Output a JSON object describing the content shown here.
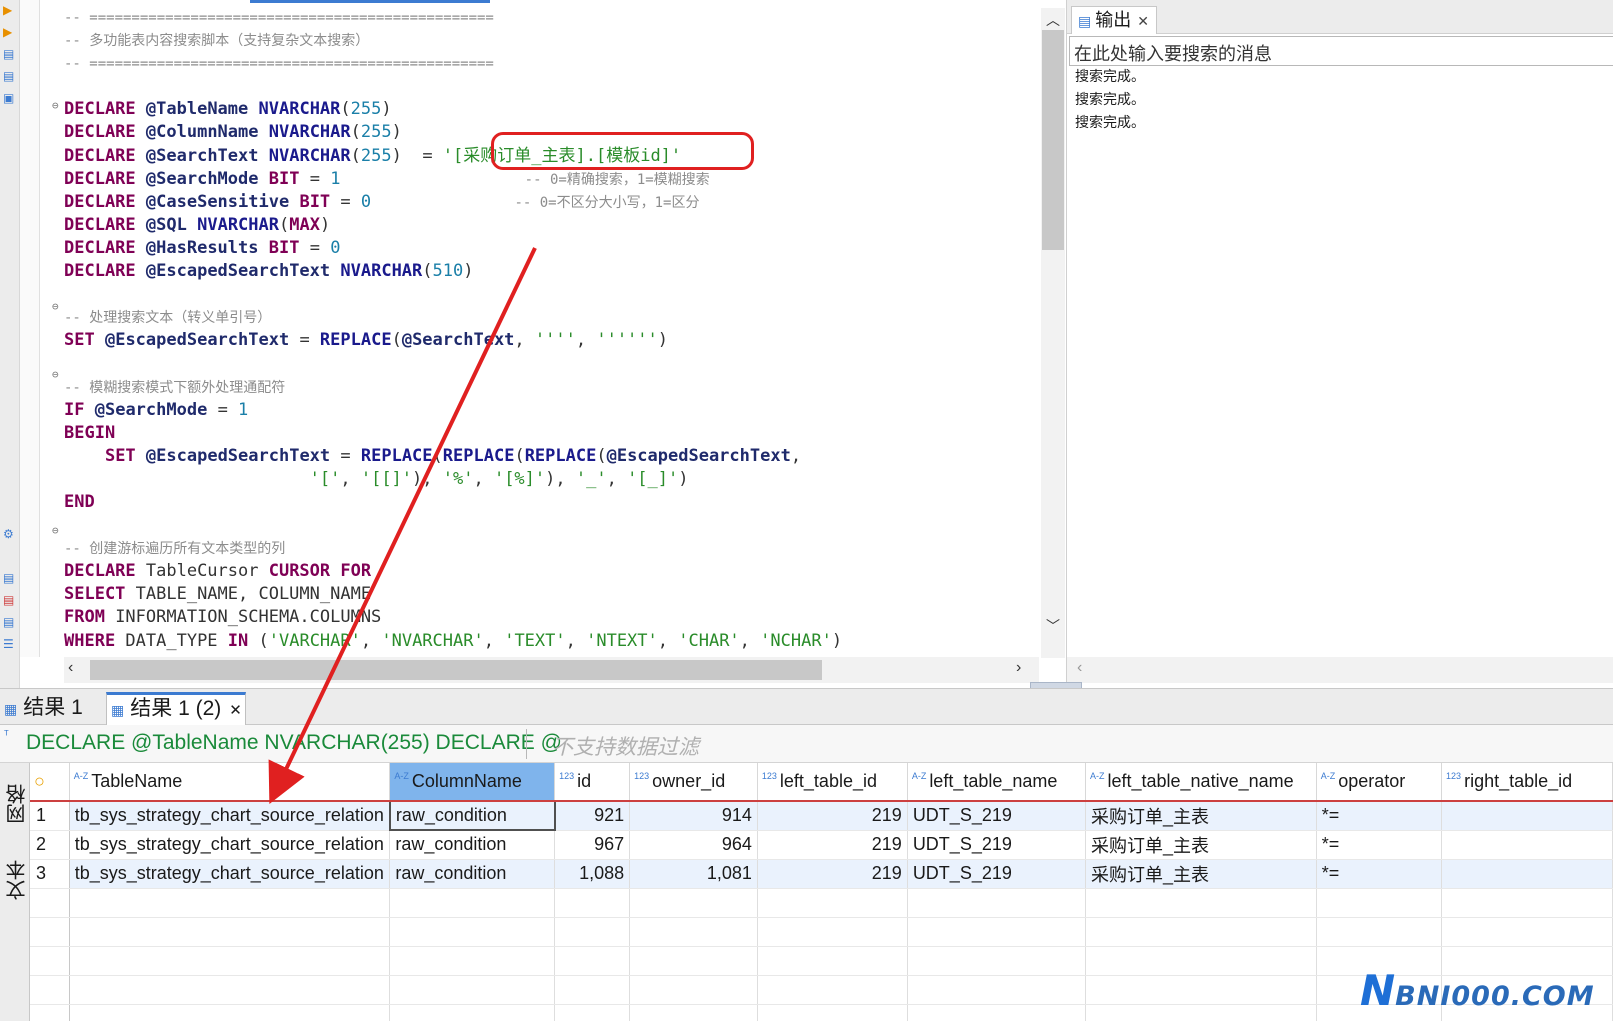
{
  "editor": {
    "lines": [
      [
        [
          "cmt",
          "-- ================================================"
        ]
      ],
      [
        [
          "cmt",
          "-- 多功能表内容搜索脚本（支持复杂文本搜索）"
        ]
      ],
      [
        [
          "cmt",
          "-- ================================================"
        ]
      ],
      [
        [
          "plain",
          ""
        ]
      ],
      [
        [
          "kw",
          "DECLARE"
        ],
        [
          "plain",
          " "
        ],
        [
          "var",
          "@TableName"
        ],
        [
          "plain",
          " "
        ],
        [
          "fn",
          "NVARCHAR"
        ],
        [
          "plain",
          "("
        ],
        [
          "num",
          "255"
        ],
        [
          "plain",
          ")"
        ]
      ],
      [
        [
          "kw",
          "DECLARE"
        ],
        [
          "plain",
          " "
        ],
        [
          "var",
          "@ColumnName"
        ],
        [
          "plain",
          " "
        ],
        [
          "fn",
          "NVARCHAR"
        ],
        [
          "plain",
          "("
        ],
        [
          "num",
          "255"
        ],
        [
          "plain",
          ")"
        ]
      ],
      [
        [
          "kw",
          "DECLARE"
        ],
        [
          "plain",
          " "
        ],
        [
          "var",
          "@SearchText"
        ],
        [
          "plain",
          " "
        ],
        [
          "fn",
          "NVARCHAR"
        ],
        [
          "plain",
          "("
        ],
        [
          "num",
          "255"
        ],
        [
          "plain",
          ")  = "
        ],
        [
          "str",
          "'[采购订单_主表].[模板id]'"
        ]
      ],
      [
        [
          "kw",
          "DECLARE"
        ],
        [
          "plain",
          " "
        ],
        [
          "var",
          "@SearchMode"
        ],
        [
          "plain",
          " "
        ],
        [
          "kw",
          "BIT"
        ],
        [
          "plain",
          " = "
        ],
        [
          "num",
          "1"
        ],
        [
          "plain",
          "                  "
        ],
        [
          "cmt",
          "-- 0=精确搜索，1=模糊搜索"
        ]
      ],
      [
        [
          "kw",
          "DECLARE"
        ],
        [
          "plain",
          " "
        ],
        [
          "var",
          "@CaseSensitive"
        ],
        [
          "plain",
          " "
        ],
        [
          "kw",
          "BIT"
        ],
        [
          "plain",
          " = "
        ],
        [
          "num",
          "0"
        ],
        [
          "plain",
          "              "
        ],
        [
          "cmt",
          "-- 0=不区分大小写，1=区分"
        ]
      ],
      [
        [
          "kw",
          "DECLARE"
        ],
        [
          "plain",
          " "
        ],
        [
          "var",
          "@SQL"
        ],
        [
          "plain",
          " "
        ],
        [
          "fn",
          "NVARCHAR"
        ],
        [
          "plain",
          "("
        ],
        [
          "kw",
          "MAX"
        ],
        [
          "plain",
          ")"
        ]
      ],
      [
        [
          "kw",
          "DECLARE"
        ],
        [
          "plain",
          " "
        ],
        [
          "var",
          "@HasResults"
        ],
        [
          "plain",
          " "
        ],
        [
          "kw",
          "BIT"
        ],
        [
          "plain",
          " = "
        ],
        [
          "num",
          "0"
        ]
      ],
      [
        [
          "kw",
          "DECLARE"
        ],
        [
          "plain",
          " "
        ],
        [
          "var",
          "@EscapedSearchText"
        ],
        [
          "plain",
          " "
        ],
        [
          "fn",
          "NVARCHAR"
        ],
        [
          "plain",
          "("
        ],
        [
          "num",
          "510"
        ],
        [
          "plain",
          ")"
        ]
      ],
      [
        [
          "plain",
          ""
        ]
      ],
      [
        [
          "cmt",
          "-- 处理搜索文本（转义单引号）"
        ]
      ],
      [
        [
          "kw",
          "SET"
        ],
        [
          "plain",
          " "
        ],
        [
          "var",
          "@EscapedSearchText"
        ],
        [
          "plain",
          " = "
        ],
        [
          "fn",
          "REPLACE"
        ],
        [
          "plain",
          "("
        ],
        [
          "var",
          "@SearchText"
        ],
        [
          "plain",
          ", "
        ],
        [
          "str",
          "''''"
        ],
        [
          "plain",
          ", "
        ],
        [
          "str",
          "''''''"
        ],
        [
          "plain",
          ")"
        ]
      ],
      [
        [
          "plain",
          ""
        ]
      ],
      [
        [
          "cmt",
          "-- 模糊搜索模式下额外处理通配符"
        ]
      ],
      [
        [
          "kw",
          "IF"
        ],
        [
          "plain",
          " "
        ],
        [
          "var",
          "@SearchMode"
        ],
        [
          "plain",
          " = "
        ],
        [
          "num",
          "1"
        ]
      ],
      [
        [
          "kw",
          "BEGIN"
        ]
      ],
      [
        [
          "plain",
          "    "
        ],
        [
          "kw",
          "SET"
        ],
        [
          "plain",
          " "
        ],
        [
          "var",
          "@EscapedSearchText"
        ],
        [
          "plain",
          " = "
        ],
        [
          "fn",
          "REPLACE"
        ],
        [
          "plain",
          "("
        ],
        [
          "fn",
          "REPLACE"
        ],
        [
          "plain",
          "("
        ],
        [
          "fn",
          "REPLACE"
        ],
        [
          "plain",
          "("
        ],
        [
          "var",
          "@EscapedSearchText"
        ],
        [
          "plain",
          ","
        ]
      ],
      [
        [
          "plain",
          "                        "
        ],
        [
          "str",
          "'['"
        ],
        [
          "plain",
          ", "
        ],
        [
          "str",
          "'[[]'"
        ],
        [
          "plain",
          "), "
        ],
        [
          "str",
          "'%'"
        ],
        [
          "plain",
          ", "
        ],
        [
          "str",
          "'[%]'"
        ],
        [
          "plain",
          "), "
        ],
        [
          "str",
          "'_'"
        ],
        [
          "plain",
          ", "
        ],
        [
          "str",
          "'[_]'"
        ],
        [
          "plain",
          ")"
        ]
      ],
      [
        [
          "kw",
          "END"
        ]
      ],
      [
        [
          "plain",
          ""
        ]
      ],
      [
        [
          "cmt",
          "-- 创建游标遍历所有文本类型的列"
        ]
      ],
      [
        [
          "kw",
          "DECLARE"
        ],
        [
          "plain",
          " TableCursor "
        ],
        [
          "kw",
          "CURSOR FOR"
        ]
      ],
      [
        [
          "kw",
          "SELECT"
        ],
        [
          "plain",
          " TABLE_NAME, COLUMN_NAME"
        ]
      ],
      [
        [
          "kw",
          "FROM"
        ],
        [
          "plain",
          " INFORMATION_SCHEMA.COLUMNS"
        ]
      ],
      [
        [
          "kw",
          "WHERE"
        ],
        [
          "plain",
          " DATA_TYPE "
        ],
        [
          "kw",
          "IN"
        ],
        [
          "plain",
          " ("
        ],
        [
          "str",
          "'VARCHAR'"
        ],
        [
          "plain",
          ", "
        ],
        [
          "str",
          "'NVARCHAR'"
        ],
        [
          "plain",
          ", "
        ],
        [
          "str",
          "'TEXT'"
        ],
        [
          "plain",
          ", "
        ],
        [
          "str",
          "'NTEXT'"
        ],
        [
          "plain",
          ", "
        ],
        [
          "str",
          "'CHAR'"
        ],
        [
          "plain",
          ", "
        ],
        [
          "str",
          "'NCHAR'"
        ],
        [
          "plain",
          ")"
        ]
      ]
    ]
  },
  "output": {
    "tab_label": "输出",
    "search_placeholder": "在此处输入要搜索的消息",
    "lines": [
      "搜索完成。",
      "搜索完成。",
      "搜索完成。"
    ]
  },
  "results": {
    "tabs": [
      "结果 1",
      "结果 1 (2)"
    ],
    "query_text": "DECLARE @TableName NVARCHAR(255) DECLARE @",
    "filter_placeholder": "不支持数据过滤",
    "side_tabs": [
      "网格",
      "文本"
    ],
    "columns": [
      {
        "label": "TableName",
        "type": "A-Z"
      },
      {
        "label": "ColumnName",
        "type": "A-Z"
      },
      {
        "label": "id",
        "type": "123"
      },
      {
        "label": "owner_id",
        "type": "123"
      },
      {
        "label": "left_table_id",
        "type": "123"
      },
      {
        "label": "left_table_name",
        "type": "A-Z"
      },
      {
        "label": "left_table_native_name",
        "type": "A-Z"
      },
      {
        "label": "operator",
        "type": "A-Z"
      },
      {
        "label": "right_table_id",
        "type": "123"
      }
    ],
    "rows": [
      [
        "1",
        "tb_sys_strategy_chart_source_relation",
        "raw_condition",
        "921",
        "914",
        "219",
        "UDT_S_219",
        "采购订单_主表",
        "*=",
        ""
      ],
      [
        "2",
        "tb_sys_strategy_chart_source_relation",
        "raw_condition",
        "967",
        "964",
        "219",
        "UDT_S_219",
        "采购订单_主表",
        "*=",
        ""
      ],
      [
        "3",
        "tb_sys_strategy_chart_source_relation",
        "raw_condition",
        "1,088",
        "1,081",
        "219",
        "UDT_S_219",
        "采购订单_主表",
        "*=",
        ""
      ]
    ]
  },
  "watermark": {
    "n": "N",
    "rest": "BNI000.COM"
  },
  "colors": {
    "accent": "#3c7bd1",
    "annotation_red": "#e02020",
    "keyword": "#7f0055",
    "string": "#2a8c2a"
  }
}
